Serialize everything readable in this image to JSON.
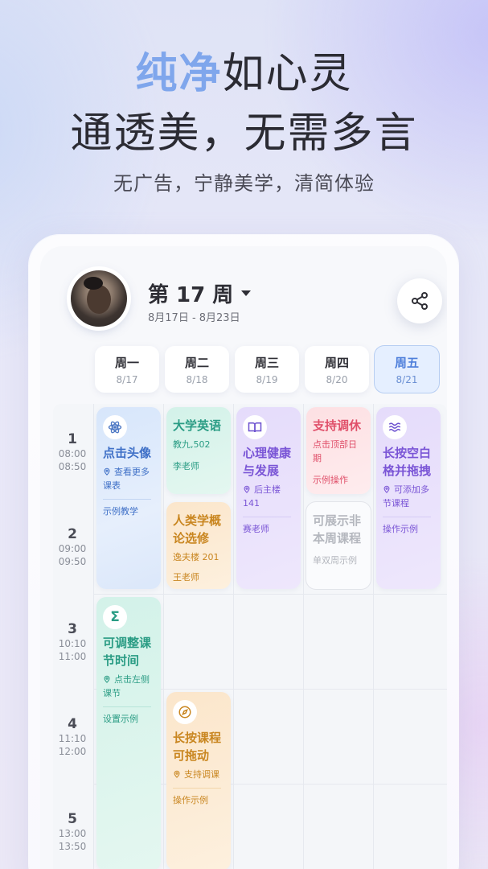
{
  "hero": {
    "line1_accent": "纯净",
    "line1_rest": "如心灵",
    "line2": "通透美，无需多言",
    "subtitle": "无广告，宁静美学，清简体验"
  },
  "header": {
    "week": "第 17 周",
    "date_range": "8月17日 - 8月23日"
  },
  "days": [
    {
      "name": "周一",
      "date": "8/17"
    },
    {
      "name": "周二",
      "date": "8/18"
    },
    {
      "name": "周三",
      "date": "8/19"
    },
    {
      "name": "周四",
      "date": "8/20"
    },
    {
      "name": "周五",
      "date": "8/21"
    }
  ],
  "slots": [
    {
      "num": "1",
      "start": "08:00",
      "end": "08:50"
    },
    {
      "num": "2",
      "start": "09:00",
      "end": "09:50"
    },
    {
      "num": "3",
      "start": "10:10",
      "end": "11:00"
    },
    {
      "num": "4",
      "start": "11:10",
      "end": "12:00"
    },
    {
      "num": "5",
      "start": "13:00",
      "end": "13:50"
    }
  ],
  "courses": {
    "mon1": {
      "title": "点击头像",
      "loc": "查看更多课表",
      "teacher": "示例教学"
    },
    "mon3": {
      "title": "可调整课节时间",
      "loc": "点击左侧课节",
      "teacher": "设置示例"
    },
    "tue1": {
      "title": "大学英语",
      "loc": "教九,502",
      "teacher": "李老师"
    },
    "tue2": {
      "title": "人类学概论选修",
      "loc": "逸夫楼 201",
      "teacher": "王老师"
    },
    "tue4": {
      "title": "长按课程可拖动",
      "loc": "支持调课",
      "teacher": "操作示例"
    },
    "wed1": {
      "title": "心理健康与发展",
      "loc": "后主楼 141",
      "teacher": "赛老师"
    },
    "thu1": {
      "title": "支持调休",
      "loc": "点击顶部日期",
      "teacher": "示例操作"
    },
    "thu2": {
      "title": "可展示非本周课程",
      "loc": "单双周示例"
    },
    "fri1": {
      "title": "长按空白格并拖拽",
      "loc": "可添加多节课程",
      "teacher": "操作示例"
    }
  },
  "colors": {
    "accent_blue": "#7fa6ec",
    "active_day": "#4e7fdb"
  },
  "icons": [
    "atom-icon",
    "sigma-icon",
    "book-icon",
    "compass-icon",
    "waves-icon",
    "share-icon",
    "location-pin-icon"
  ]
}
